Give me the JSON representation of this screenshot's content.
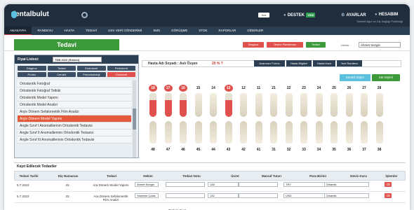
{
  "header": {
    "logo": "dentalbulut",
    "search_btn": "Ara",
    "support": "DESTEK",
    "new_badge": "YENİ",
    "settings": "AYARLAR",
    "account": "HESABIM",
    "subnote": "Selektif Ağız ve Diş Sağlığı Polikliniği"
  },
  "nav": [
    "ANASAYFA",
    "RANDEVU",
    "HASTA",
    "TEDAVİ",
    "USS VERİ GÖNDERİMİ",
    "SMS",
    "GÖRÜŞME",
    "STOK",
    "RAPORLAR",
    "GİDERLER"
  ],
  "page": {
    "title": "Tedavi",
    "buttons": [
      "Diagnoz",
      "Tedavi Planlaması",
      "Tedavi"
    ],
    "hekim_label": "Hekim :",
    "hekim_value": "Ahmet Sezgin"
  },
  "fiyat": {
    "label": "Fiyat Listesi:",
    "select": "TDB 2022 (Sistem)",
    "categories": [
      "Diagnoz",
      "Tedavi",
      "Endodonti",
      "Pedodonti",
      "Protez",
      "Cerrahi",
      "Periodontoloji",
      "Ortodonti"
    ],
    "items": [
      "Ortodontik Fotoğraf",
      "Ortodontik Fotoğraf Tetkiki",
      "Ortodontik Model Yapımı",
      "Ortodontik Model Analizi",
      "Arşiv Dönem Sefalometrik Film Analizi",
      "Arşiv Dönem Model Yapımı",
      "Angle Sınıf I Anomalilerinin Ortodontik Tedavisi",
      "Angle Sınıf II Anomalilerinin Ortodontik Tedavisi",
      "Angle Sınıf III Anomalilerinin Ortodontik Tedavisi"
    ]
  },
  "patient": {
    "label": "Hasta Adı Soyadı : Aslı Özşen",
    "discount": "20 % ?",
    "buttons": [
      "Anamnez Formu",
      "Hasta Bilgileri",
      "Hasta Kartı",
      "Yeni Randevu"
    ],
    "toggle_left": "Sürekli Dişler",
    "toggle_right": "Süt Dişleri"
  },
  "teeth": {
    "upper": [
      "18",
      "17",
      "16",
      "15",
      "14",
      "13",
      "12",
      "11",
      "21",
      "22",
      "23",
      "24",
      "25",
      "26",
      "27",
      "28"
    ],
    "lower": [
      "48",
      "47",
      "46",
      "45",
      "44",
      "43",
      "42",
      "41",
      "31",
      "32",
      "33",
      "34",
      "35",
      "36",
      "37",
      "38"
    ],
    "marked": [
      "18",
      "17",
      "16",
      "13"
    ]
  },
  "table": {
    "title": "Kayıt Edilecek Tedaviler",
    "headers": [
      "Tedavi Tarihi",
      "Diş Numarası",
      "Tedavi",
      "Hekim",
      "Tedavi Notu",
      "Ücret",
      "Masraf Tutarı",
      "Para Birimi",
      "Döviz Kuru",
      "İşlemler"
    ],
    "rows": [
      {
        "date": "5.7.2022",
        "tooth": "33",
        "treat": "Ara Dönem Model Yapımı",
        "hekim": "Ahmet Sezgin",
        "fee": "148",
        "currency": "TRY",
        "rate": "Dinamik"
      },
      {
        "date": "5.7.2022",
        "tooth": "33",
        "treat": "Ara Dönem Sefalometrik Film Analizi",
        "hekim": "Yasemin Çolak",
        "fee": "132",
        "currency": "USD",
        "rate": "Dinamik"
      }
    ],
    "total_label": "Toplam Fiyat",
    "total_currency": "TRY"
  },
  "colors": {
    "header": "#1f2d3d",
    "accent": "#3d9a3a",
    "danger": "#e0504d"
  }
}
